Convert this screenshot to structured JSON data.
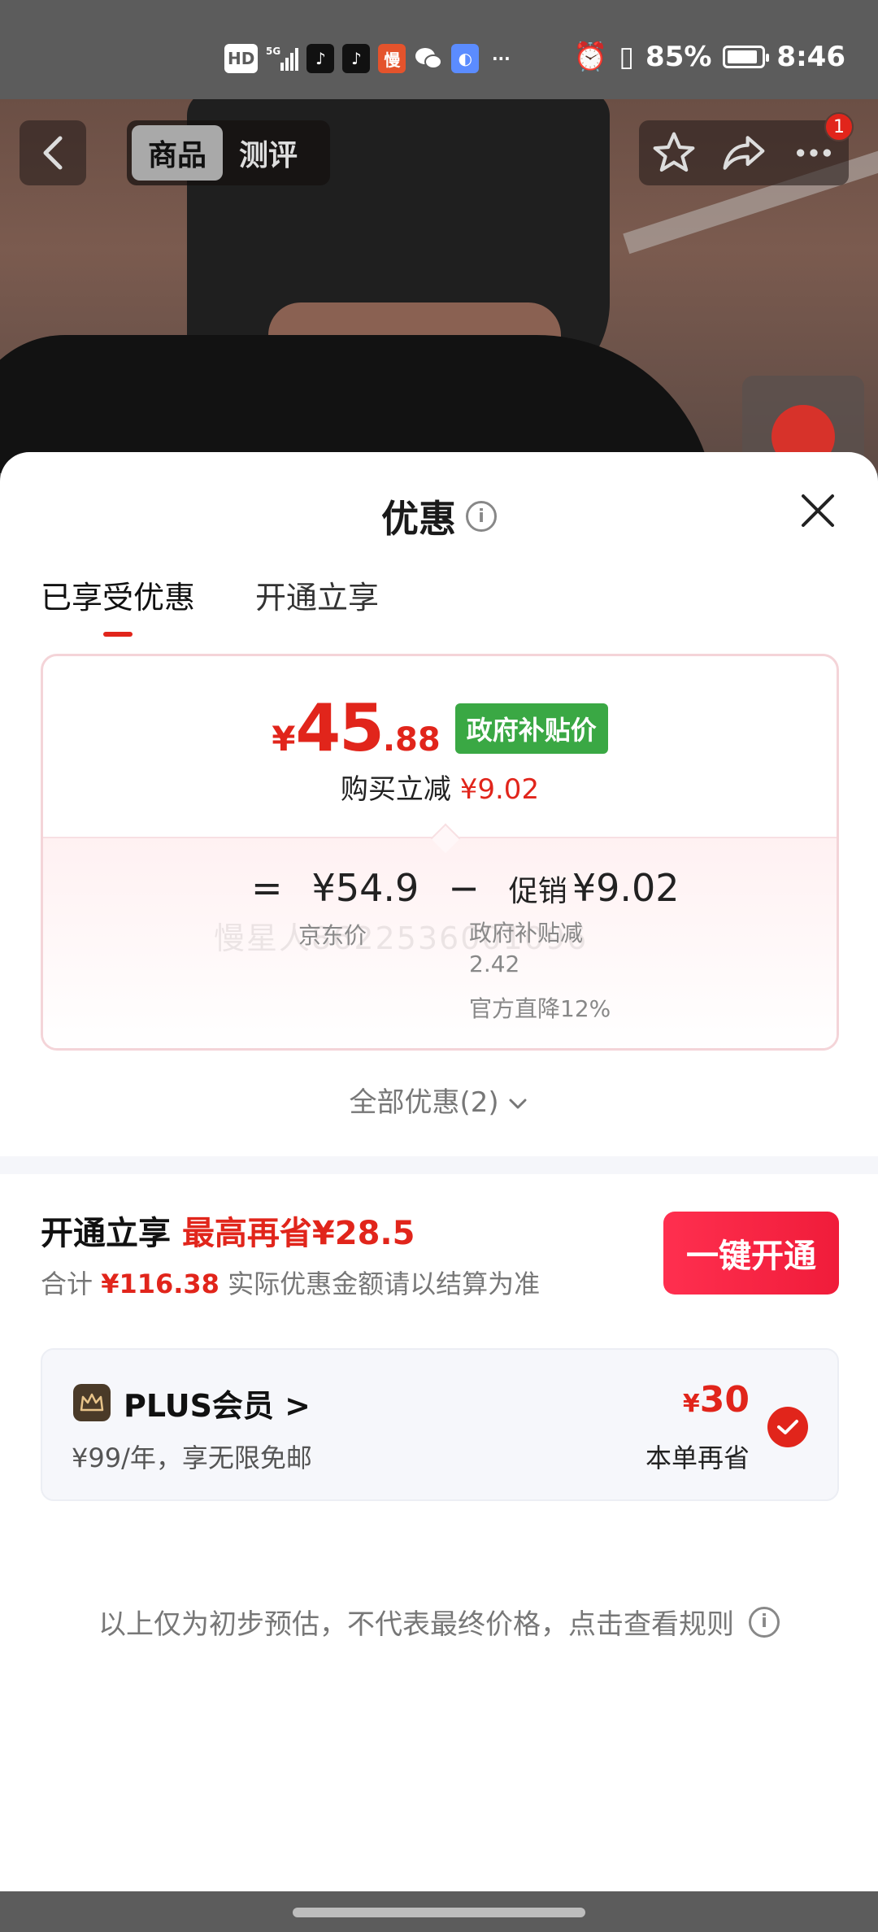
{
  "status_bar": {
    "time": "8:46",
    "battery": "85%",
    "icons": [
      "hd-icon",
      "5g-signal-icon",
      "tiktok-icon",
      "tiktok-icon",
      "manxing-app-icon",
      "wechat-icon",
      "browser-icon",
      "more-dots-icon",
      "alarm-icon",
      "vibrate-icon"
    ],
    "hd_label": "HD",
    "app_label": "慢"
  },
  "nav": {
    "tab_product": "商品",
    "tab_review": "测评",
    "notification_count": "1"
  },
  "sheet": {
    "title": "优惠",
    "tabs": [
      {
        "label": "已享受优惠",
        "active": true
      },
      {
        "label": "开通立享",
        "active": false
      }
    ],
    "price": {
      "currency": "¥",
      "integer": "45",
      "decimal": ".88",
      "tag": "政府补贴价",
      "reduce_label": "购买立减",
      "reduce_value": "¥9.02"
    },
    "calc": {
      "equals": "=",
      "jd_price": "¥54.9",
      "jd_label": "京东价",
      "minus": "−",
      "promo_label": "促销",
      "promo_value": "¥9.02",
      "gov_subsidy_label": "政府补贴减",
      "gov_subsidy_value": "2.42",
      "official_drop": "官方直降12%",
      "watermark": "慢星人8622536001096"
    },
    "all_offers": "全部优惠(2)"
  },
  "open_section": {
    "title": "开通立享",
    "highlight": "最高再省¥28.5",
    "total_prefix": "合计",
    "total_value": "¥116.38",
    "total_note": "实际优惠金额请以结算为准",
    "button": "一键开通"
  },
  "plus_card": {
    "name": "PLUS会员 >",
    "desc": "¥99/年，享无限免邮",
    "save_currency": "¥",
    "save_value": "30",
    "save_label": "本单再省"
  },
  "disclaimer": "以上仅为初步预估，不代表最终价格，点击查看规则",
  "colors": {
    "accent": "#e1251b",
    "subsidy_green": "#3aa844"
  }
}
